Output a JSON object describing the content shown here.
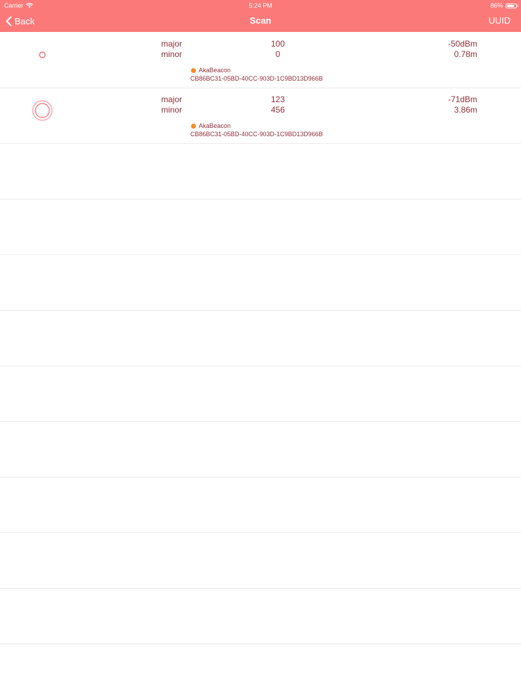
{
  "status_bar": {
    "carrier": "Carrier",
    "time": "5:24 PM",
    "battery": "86%",
    "battery_level": 0.86
  },
  "nav": {
    "back_label": "Back",
    "title": "Scan",
    "uuid_label": "UUID"
  },
  "colors": {
    "header": "#fb7a79",
    "text": "#8e2f3a",
    "dot": "#f58a1f",
    "ring": "#f06a73"
  },
  "beacons": [
    {
      "major_label": "major",
      "minor_label": "minor",
      "major": "100",
      "minor": "0",
      "rssi": "-50dBm",
      "distance": "0.78m",
      "name": "AkaBeacon",
      "uuid": "CB86BC31-05BD-40CC-903D-1C9BD13D966B",
      "proximity_icon": "near-proximity-icon"
    },
    {
      "major_label": "major",
      "minor_label": "minor",
      "major": "123",
      "minor": "456",
      "rssi": "-71dBm",
      "distance": "3.86m",
      "name": "AkaBeacon",
      "uuid": "CB86BC31-05BD-40CC-903D-1C9BD13D966B",
      "proximity_icon": "far-proximity-icon"
    }
  ]
}
